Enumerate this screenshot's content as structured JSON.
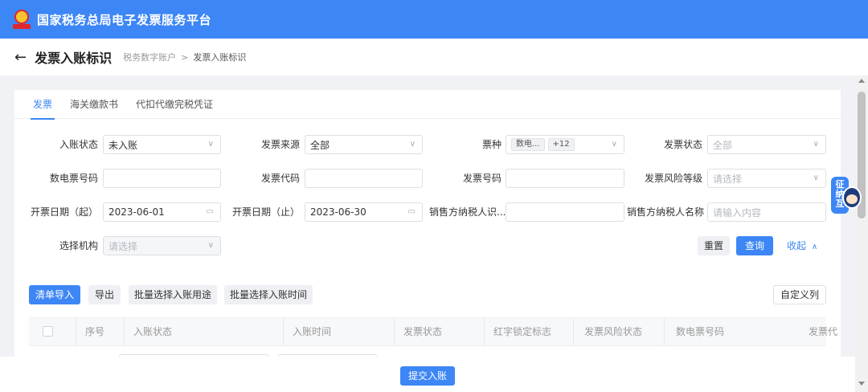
{
  "app": {
    "title": "国家税务总局电子发票服务平台"
  },
  "page": {
    "back_icon": "left-arrow-icon",
    "title": "发票入账标识",
    "breadcrumb": [
      "税务数字账户",
      "发票入账标识"
    ],
    "breadcrumb_separator": ">"
  },
  "tabs": [
    {
      "label": "发票",
      "active": true
    },
    {
      "label": "海关缴款书",
      "active": false
    },
    {
      "label": "代扣代缴完税凭证",
      "active": false
    }
  ],
  "filters": {
    "entry_status": {
      "label": "入账状态",
      "value": "未入账"
    },
    "invoice_source": {
      "label": "发票来源",
      "value": "全部"
    },
    "invoice_type": {
      "label": "票种",
      "chip": "数电...",
      "more": "+12"
    },
    "invoice_status": {
      "label": "发票状态",
      "placeholder": "全部"
    },
    "digital_invoice_no": {
      "label": "数电票号码",
      "value": ""
    },
    "invoice_code": {
      "label": "发票代码",
      "value": ""
    },
    "invoice_no": {
      "label": "发票号码",
      "value": ""
    },
    "risk_level": {
      "label": "发票风险等级",
      "placeholder": "请选择"
    },
    "date_start": {
      "label": "开票日期（起）",
      "value": "2023-06-01"
    },
    "date_end": {
      "label": "开票日期（止）",
      "value": "2023-06-30"
    },
    "seller_tax_id": {
      "label": "销售方纳税人识...",
      "value": ""
    },
    "seller_name": {
      "label": "销售方纳税人名称",
      "placeholder": "请输入内容"
    },
    "org": {
      "label": "选择机构",
      "placeholder": "请选择"
    }
  },
  "actions": {
    "reset": "重置",
    "query": "查询",
    "collapse": "收起",
    "import_list": "清单导入",
    "export": "导出",
    "batch_purpose": "批量选择入账用途",
    "batch_time": "批量选择入账时间",
    "custom_columns": "自定义列",
    "submit": "提交入账"
  },
  "table": {
    "columns": [
      "序号",
      "入账状态",
      "入账时间",
      "发票状态",
      "红字锁定标志",
      "发票风险状态",
      "数电票号码",
      "发票代"
    ]
  },
  "helper": {
    "label_lines": [
      "征",
      "纳",
      "互",
      "动"
    ]
  },
  "colors": {
    "primary": "#3d86f5",
    "emblem_red": "#e0262d",
    "emblem_gold": "#f4c430"
  }
}
